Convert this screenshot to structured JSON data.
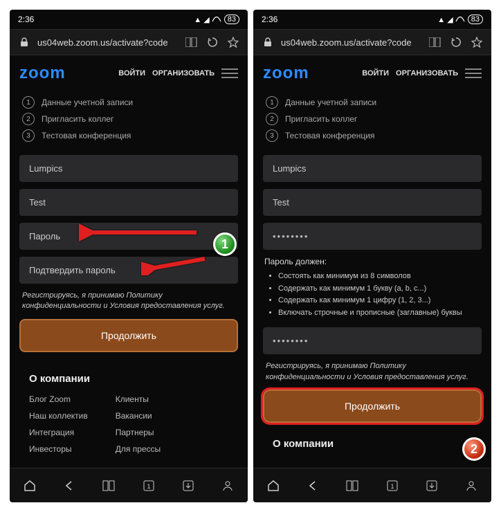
{
  "status": {
    "time": "2:36",
    "battery": "83"
  },
  "addr": {
    "url": "us04web.zoom.us/activate?code"
  },
  "header": {
    "logo": "zoom",
    "login": "ВОЙТИ",
    "organize": "ОРГАНИЗОВАТЬ"
  },
  "steps": [
    "Данные учетной записи",
    "Пригласить коллег",
    "Тестовая конференция"
  ],
  "fields": {
    "firstname": "Lumpics",
    "lastname": "Test",
    "password_ph": "Пароль",
    "confirm_ph": "Подтвердить пароль",
    "password_val": "••••••••",
    "confirm_val": "••••••••"
  },
  "rules_title": "Пароль должен:",
  "rules": [
    "Состоять как минимум из 8 символов",
    "Содержать как минимум 1 букву (a, b, c...)",
    "Содержать как минимум 1 цифру (1, 2, 3...)",
    "Включать строчные и прописные (заглавные) буквы"
  ],
  "terms": "Регистрируясь, я принимаю Политику конфиденциальности и Условия предоставления услуг.",
  "btn": "Продолжить",
  "footer": {
    "title": "О компании",
    "col1": [
      "Блог Zoom",
      "Наш коллектив",
      "Интеграция",
      "Инвесторы"
    ],
    "col2": [
      "Клиенты",
      "Вакансии",
      "Партнеры",
      "Для прессы"
    ]
  },
  "markers": {
    "one": "1",
    "two": "2"
  }
}
